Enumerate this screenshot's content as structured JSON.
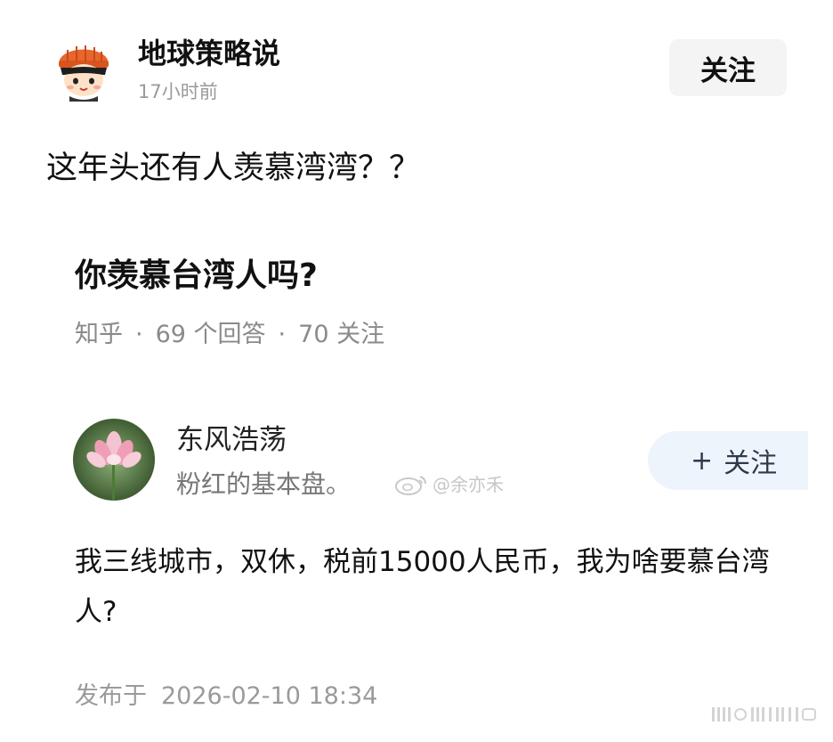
{
  "post": {
    "author_name": "地球策略说",
    "time_ago": "17小时前",
    "follow_label": "关注",
    "text": "这年头还有人羡慕湾湾？？"
  },
  "card": {
    "question_title": "你羡慕台湾人吗?",
    "source": "知乎",
    "answers_count": "69",
    "answers_label": "个回答",
    "followers_count": "70",
    "followers_label": "关注",
    "answerer": {
      "name": "东风浩荡",
      "bio": "粉红的基本盘。",
      "follow_label": "关注"
    },
    "watermark_text": "@余亦禾",
    "answer_text": "我三线城市，双休，税前15000人民币，我为啥要慕台湾人?",
    "publish_label": "发布于",
    "publish_time": "2026-02-10 18:34"
  },
  "colors": {
    "follow_bg": "#f4f4f4",
    "answer_follow_bg": "#eef4fc",
    "meta_gray": "#8a8a8a"
  },
  "icons": {
    "author_avatar": "cartoon-avatar-icon",
    "answerer_avatar": "lotus-avatar-icon",
    "watermark": "weibo-icon"
  }
}
